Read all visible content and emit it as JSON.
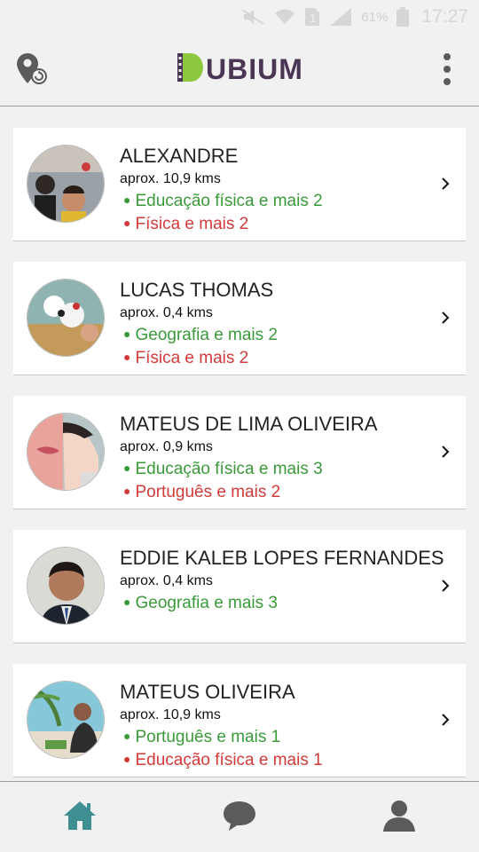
{
  "status_bar": {
    "battery": "61%",
    "time": "17:27"
  },
  "app": {
    "logo_text": "UBIUM",
    "brand_green": "#8dc63f",
    "brand_purple": "#4a3555",
    "accent_teal": "#3d8f91"
  },
  "header": {
    "left_icon": "location-refresh-icon",
    "right_icon": "more-vert-icon"
  },
  "tutors": [
    {
      "name": "ALEXANDRE",
      "distance": "aprox. 10,9 kms",
      "subjects": [
        {
          "text": "Educação física e mais 2",
          "color": "green"
        },
        {
          "text": "Física e mais 2",
          "color": "red"
        }
      ]
    },
    {
      "name": "LUCAS THOMAS",
      "distance": "aprox. 0,4 kms",
      "subjects": [
        {
          "text": "Geografia e mais 2",
          "color": "green"
        },
        {
          "text": "Física e mais 2",
          "color": "red"
        }
      ]
    },
    {
      "name": "MATEUS DE LIMA OLIVEIRA",
      "distance": "aprox. 0,9 kms",
      "subjects": [
        {
          "text": "Educação física e mais 3",
          "color": "green"
        },
        {
          "text": "Português e mais 2",
          "color": "red"
        }
      ]
    },
    {
      "name": "EDDIE KALEB LOPES FERNANDES",
      "distance": "aprox. 0,4 kms",
      "subjects": [
        {
          "text": "Geografia e mais 3",
          "color": "green"
        }
      ]
    },
    {
      "name": "MATEUS OLIVEIRA",
      "distance": "aprox. 10,9 kms",
      "subjects": [
        {
          "text": "Português e mais 1",
          "color": "green"
        },
        {
          "text": "Educação física e mais 1",
          "color": "red"
        }
      ]
    }
  ],
  "bottom_nav": {
    "items": [
      {
        "icon": "home-icon",
        "active": true
      },
      {
        "icon": "chat-icon",
        "active": false
      },
      {
        "icon": "profile-icon",
        "active": false
      }
    ]
  }
}
